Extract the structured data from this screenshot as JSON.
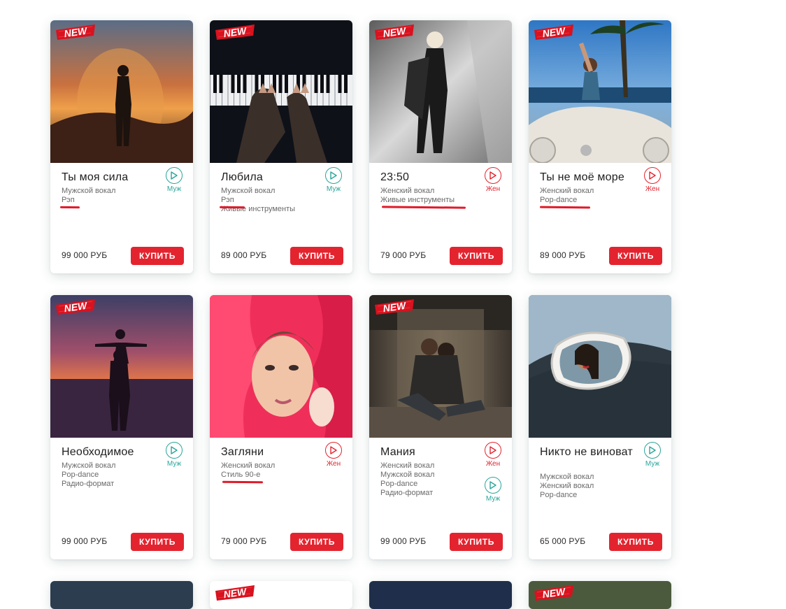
{
  "new_badge": "NEW",
  "cards": [
    {
      "title": "Ты моя сила",
      "tags": [
        "Мужской вокал",
        "Рэп"
      ],
      "plays": [
        "Муж"
      ],
      "price": "99 000 РУБ",
      "buy": "КУПИТЬ",
      "is_new": true,
      "image": "silhouette-sunset-woman"
    },
    {
      "title": "Любила",
      "tags": [
        "Мужской вокал",
        "Рэп",
        "Живые инструменты"
      ],
      "plays": [
        "Муж"
      ],
      "price": "89 000 РУБ",
      "buy": "КУПИТЬ",
      "is_new": true,
      "image": "hands-on-piano"
    },
    {
      "title": "23:50",
      "tags": [
        "Женский вокал",
        "Живые инструменты"
      ],
      "plays": [
        "Жен"
      ],
      "price": "79 000 РУБ",
      "buy": "КУПИТЬ",
      "is_new": true,
      "image": "blonde-woman-walking-bw"
    },
    {
      "title": "Ты не моё море",
      "tags": [
        "Женский вокал",
        "Pop-dance"
      ],
      "plays": [
        "Жен"
      ],
      "price": "89 000 РУБ",
      "buy": "КУПИТЬ",
      "is_new": true,
      "image": "woman-convertible-palms"
    },
    {
      "title": "Необходимое",
      "tags": [
        "Мужской вокал",
        "Pop-dance",
        "Радио-формат"
      ],
      "plays": [
        "Муж"
      ],
      "price": "99 000 РУБ",
      "buy": "КУПИТЬ",
      "is_new": true,
      "image": "couple-silhouette-sunset"
    },
    {
      "title": "Загляни",
      "tags": [
        "Женский вокал",
        "Стиль 90-е"
      ],
      "plays": [
        "Жен"
      ],
      "price": "79 000 РУБ",
      "buy": "КУПИТЬ",
      "is_new": false,
      "image": "woman-red-fabric"
    },
    {
      "title": "Мания",
      "tags": [
        "Женский вокал",
        "Мужской вокал",
        "Pop-dance",
        "Радио-формат"
      ],
      "plays": [
        "Жен",
        "Муж"
      ],
      "price": "99 000 РУБ",
      "buy": "КУПИТЬ",
      "is_new": true,
      "image": "couple-elevator"
    },
    {
      "title": "Никто не виноват",
      "tags": [
        "Мужской вокал",
        "Женский вокал",
        "Pop-dance"
      ],
      "plays": [
        "Муж"
      ],
      "price": "65 000 РУБ",
      "buy": "КУПИТЬ",
      "is_new": false,
      "image": "woman-car-mirror"
    }
  ],
  "colors": {
    "accent": "#e3242f",
    "male": "#2aa59a",
    "underline": "#e01a2a"
  }
}
